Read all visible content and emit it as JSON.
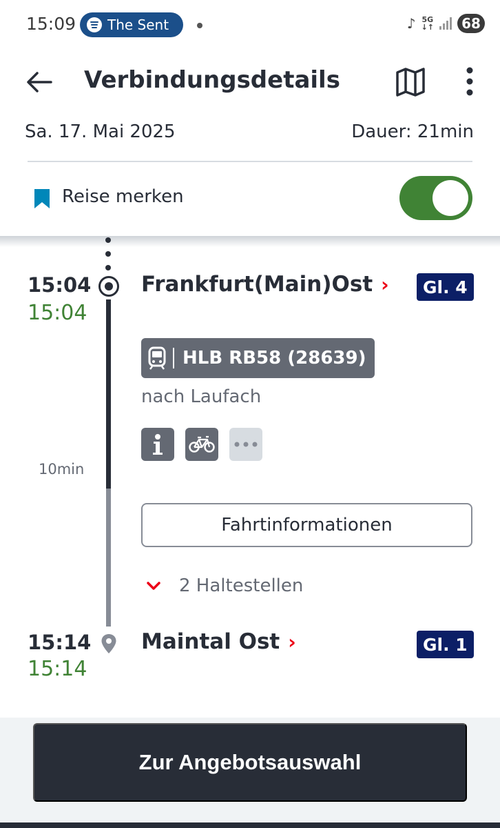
{
  "status_bar": {
    "time": "15:09",
    "media_pill_text": "The Sent",
    "network": "5G",
    "battery": "68"
  },
  "header": {
    "title": "Verbindungsdetails",
    "date": "Sa. 17. Mai 2025",
    "duration": "Dauer: 21min",
    "bookmark_label": "Reise merken",
    "bookmark_toggle_on": true,
    "icons": [
      "back-arrow-icon",
      "map-icon",
      "more-vert-icon",
      "bookmark-icon"
    ]
  },
  "journey": {
    "origin": {
      "time_planned": "15:04",
      "time_real": "15:04",
      "station": "Frankfurt(Main)Ost",
      "track": "Gl. 4"
    },
    "train": {
      "label": "HLB RB58 (28639)",
      "direction": "nach Laufach",
      "attributes": [
        "info-icon",
        "bicycle-icon",
        "more-horiz-icon"
      ]
    },
    "travel_duration": "10min",
    "details_button": "Fahrtinformationen",
    "stops_label": "2 Haltestellen",
    "destination": {
      "time_planned": "15:14",
      "time_real": "15:14",
      "station": "Maintal Ost",
      "track": "Gl. 1"
    }
  },
  "footer": {
    "cta_label": "Zur Angebotsauswahl"
  },
  "colors": {
    "text": "#282d37",
    "realtime_green": "#408335",
    "accent_red": "#ec0016",
    "track_badge": "#0c1f66",
    "toggle_on": "#408335",
    "bookmark_blue": "#0087b9"
  }
}
